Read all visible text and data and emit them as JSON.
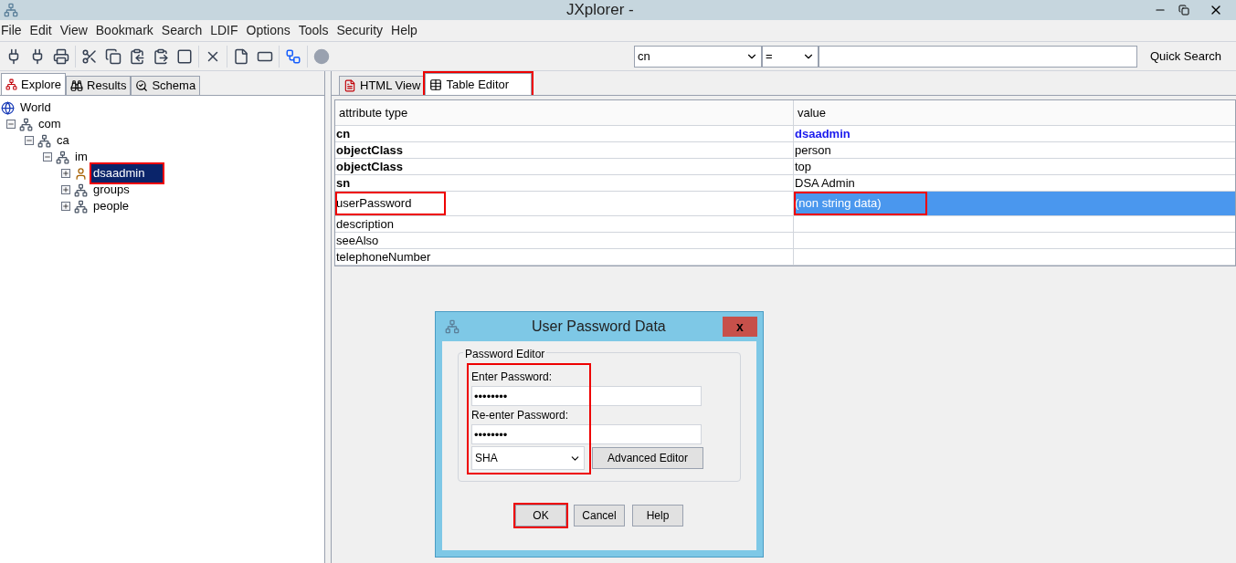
{
  "window": {
    "title": "JXplorer -"
  },
  "menu": [
    "File",
    "Edit",
    "View",
    "Bookmark",
    "Search",
    "LDIF",
    "Options",
    "Tools",
    "Security",
    "Help"
  ],
  "quick_search": {
    "attribute": "cn",
    "operator": "=",
    "button": "Quick Search"
  },
  "left_tabs": [
    {
      "label": "Explore",
      "selected": true
    },
    {
      "label": "Results",
      "selected": false
    },
    {
      "label": "Schema",
      "selected": false
    }
  ],
  "tree": [
    {
      "label": "World",
      "kind": "root",
      "children": [
        {
          "label": "com",
          "kind": "branch",
          "expanded": true,
          "children": [
            {
              "label": "ca",
              "kind": "branch",
              "expanded": true,
              "children": [
                {
                  "label": "im",
                  "kind": "branch",
                  "expanded": true,
                  "children": [
                    {
                      "label": "dsaadmin",
                      "kind": "person",
                      "expanded": false,
                      "selected": true,
                      "highlighted": true
                    },
                    {
                      "label": "groups",
                      "kind": "branch",
                      "expanded": false,
                      "selected": false,
                      "highlighted": false
                    },
                    {
                      "label": "people",
                      "kind": "branch",
                      "expanded": false,
                      "selected": false,
                      "highlighted": false
                    }
                  ]
                }
              ]
            }
          ]
        }
      ]
    }
  ],
  "right_tabs": [
    {
      "label": "HTML View",
      "selected": false,
      "highlighted": false
    },
    {
      "label": "Table Editor",
      "selected": true,
      "highlighted": true
    }
  ],
  "table": {
    "columns": [
      "attribute type",
      "value"
    ],
    "rows": [
      {
        "attribute": "cn",
        "value": "dsaadmin",
        "required": true,
        "naming": true,
        "selected": false,
        "highlighted": false
      },
      {
        "attribute": "objectClass",
        "value": "person",
        "required": true,
        "naming": false,
        "selected": false,
        "highlighted": false
      },
      {
        "attribute": "objectClass",
        "value": "top",
        "required": true,
        "naming": false,
        "selected": false,
        "highlighted": false
      },
      {
        "attribute": "sn",
        "value": "DSA Admin",
        "required": true,
        "naming": false,
        "selected": false,
        "highlighted": false
      },
      {
        "attribute": "userPassword",
        "value": "(non string data)",
        "required": false,
        "naming": false,
        "selected": true,
        "highlighted": true
      },
      {
        "attribute": "description",
        "required": false,
        "selected": false,
        "highlighted": false
      },
      {
        "attribute": "seeAlso",
        "required": false,
        "selected": false,
        "highlighted": false
      },
      {
        "attribute": "telephoneNumber",
        "required": false,
        "selected": false,
        "highlighted": false
      }
    ]
  },
  "dialog": {
    "title": "User Password Data",
    "close": "x",
    "group": "Password Editor",
    "highlighted": true,
    "fields": [
      {
        "label": "Enter Password:",
        "value": "••••••••"
      },
      {
        "label": "Re-enter Password:",
        "value": "••••••••"
      }
    ],
    "hash": "SHA",
    "advanced": "Advanced Editor",
    "buttons": [
      {
        "label": "OK",
        "highlighted": true
      },
      {
        "label": "Cancel",
        "highlighted": false
      },
      {
        "label": "Help",
        "highlighted": false
      }
    ]
  }
}
